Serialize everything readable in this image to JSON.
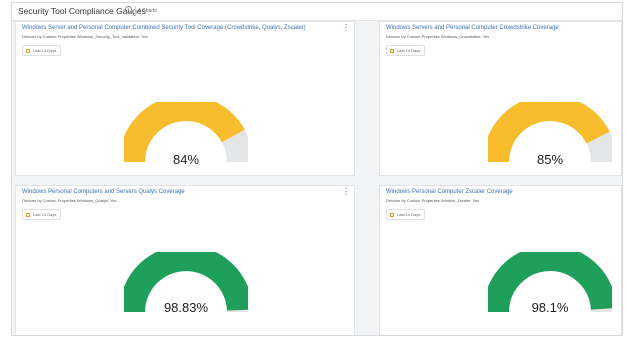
{
  "header": {
    "title": "Security Tool Compliance Gauges",
    "chart_count": "4 Charts"
  },
  "cards": [
    {
      "title": "Windows Server and Personal Computer Combined Security Tool Coverage (Crowdstrike, Qualys, Zscaler)",
      "subtitle": "Devices by Custom Properties Windows_Security_Tool_Validation: Yes",
      "filter": "Last 14 Days",
      "value_text": "84%",
      "value": 84,
      "color": "#f7bd2c"
    },
    {
      "title": "Windows Servers and Personal Computer Crowdstrike Coverage",
      "subtitle": "Devices by Custom Properties Windows_Crowdstrike: Yes",
      "filter": "Last 14 Days",
      "value_text": "85%",
      "value": 85,
      "color": "#f7bd2c"
    },
    {
      "title": "Windows Personal Computers and Servers Qualys Coverage",
      "subtitle": "Devices by Custom Properties Windows_Qualys: Yes",
      "filter": "Last 14 Days",
      "value_text": "98.83%",
      "value": 98.83,
      "color": "#1fa05a"
    },
    {
      "title": "Windows Personal Computer Zscaler Coverage",
      "subtitle": "Devices by Custom Properties Window_Zscaler: Yes",
      "filter": "Last 14 Days",
      "value_text": "98.1%",
      "value": 98.1,
      "color": "#1fa05a"
    }
  ],
  "track_color": "#e4e5e7"
}
